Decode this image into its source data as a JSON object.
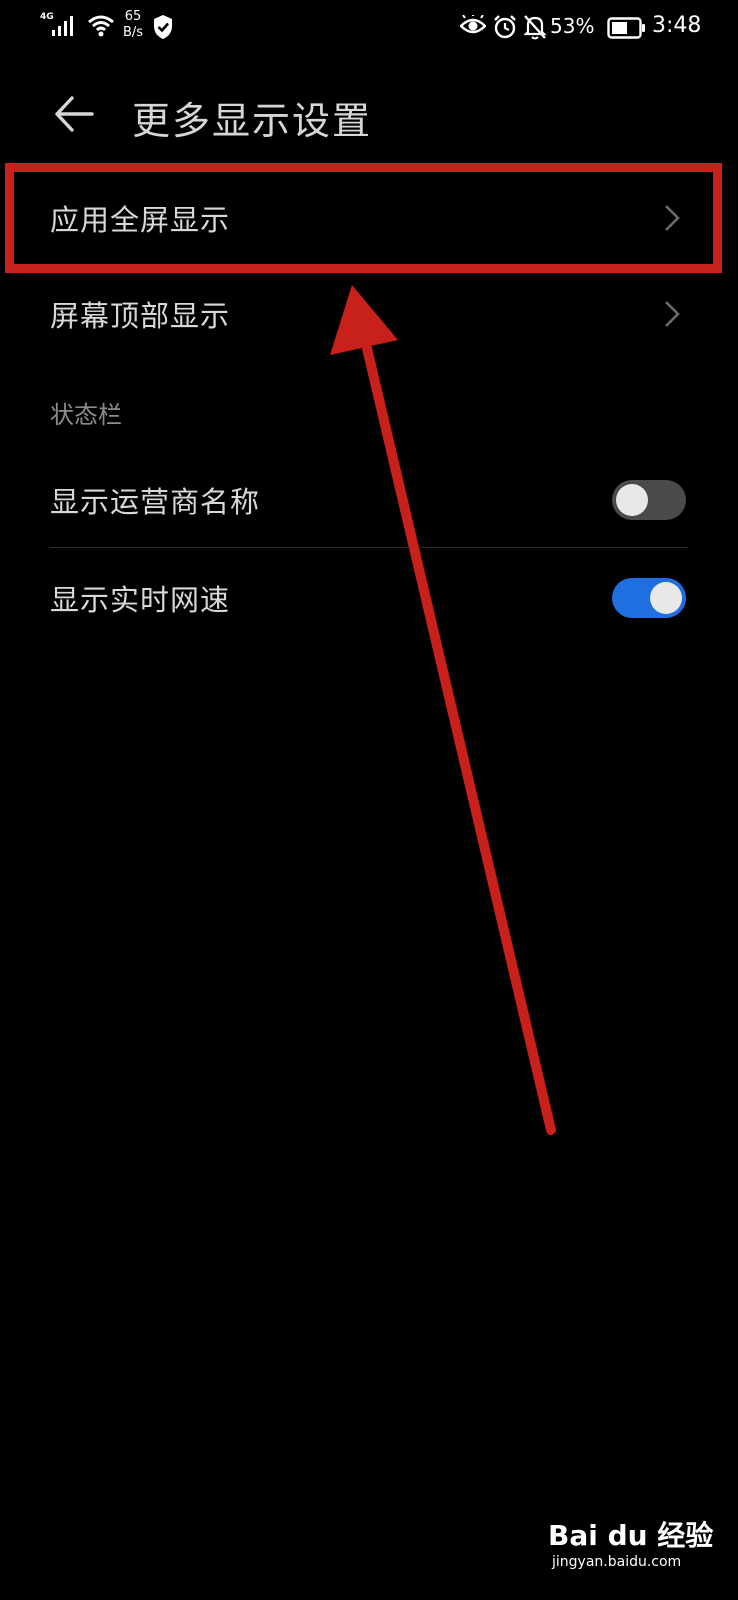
{
  "status_bar": {
    "network_type": "4G",
    "speed_value": "65",
    "speed_unit": "B/s",
    "battery_percent": "53%",
    "time": "3:48",
    "icons": [
      "signal-icon",
      "wifi-icon",
      "shield-icon",
      "eye-icon",
      "alarm-icon",
      "mute-icon",
      "battery-icon"
    ]
  },
  "header": {
    "title": "更多显示设置",
    "back_icon": "back-arrow-icon"
  },
  "items": [
    {
      "label": "应用全屏显示",
      "type": "link"
    },
    {
      "label": "屏幕顶部显示",
      "type": "link"
    }
  ],
  "status_section": {
    "title": "状态栏",
    "items": [
      {
        "label": "显示运营商名称",
        "toggle": false
      },
      {
        "label": "显示实时网速",
        "toggle": true
      }
    ]
  },
  "colors": {
    "background": "#000000",
    "accent": "#1f6fe0",
    "annotation": "#c8201a"
  },
  "watermark": {
    "logo": "Bai du 经验",
    "url": "jingyan.baidu.com"
  }
}
